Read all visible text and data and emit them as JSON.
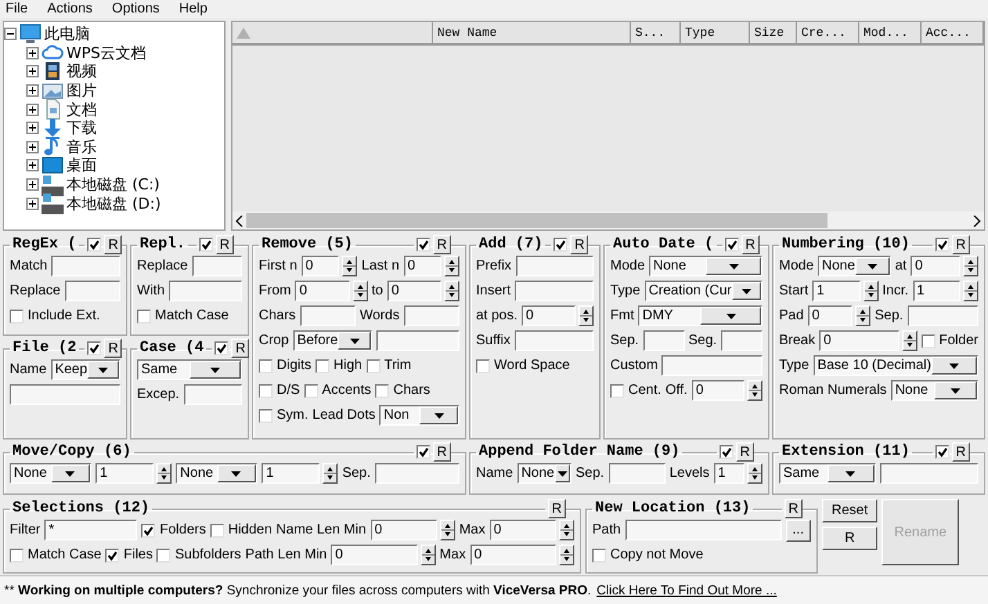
{
  "menu": [
    "File",
    "Actions",
    "Options",
    "Help"
  ],
  "tree": {
    "label": "此电脑",
    "kind": "computer",
    "expanded": true,
    "children": [
      {
        "label": "WPS云文档",
        "kind": "cloud",
        "expanded": false
      },
      {
        "label": "视频",
        "kind": "video",
        "expanded": false
      },
      {
        "label": "图片",
        "kind": "picture",
        "expanded": false
      },
      {
        "label": "文档",
        "kind": "document",
        "expanded": false
      },
      {
        "label": "下载",
        "kind": "download",
        "expanded": false
      },
      {
        "label": "音乐",
        "kind": "music",
        "expanded": false
      },
      {
        "label": "桌面",
        "kind": "desktop",
        "expanded": false
      },
      {
        "label": "本地磁盘 (C:)",
        "kind": "drive",
        "expanded": false
      },
      {
        "label": "本地磁盘 (D:)",
        "kind": "drive",
        "expanded": false
      }
    ]
  },
  "file_list": {
    "columns": [
      {
        "kind": "sort"
      },
      {
        "label": "New Name"
      },
      {
        "label": "S..."
      },
      {
        "label": "Type"
      },
      {
        "label": "Size"
      },
      {
        "label": "Cre..."
      },
      {
        "label": "Mod..."
      },
      {
        "label": "Acc..."
      }
    ]
  },
  "panels": [
    {
      "title": "RegEx (",
      "enabled": true,
      "reset": "R",
      "rows": [
        {
          "items": [
            {
              "kind": "label",
              "text": "Match"
            },
            {
              "kind": "field"
            }
          ]
        },
        {
          "items": [
            {
              "kind": "label",
              "text": "Replace"
            },
            {
              "kind": "field"
            }
          ]
        },
        {
          "items": [
            {
              "kind": "check",
              "label": "Include Ext.",
              "checked": false
            }
          ]
        }
      ]
    },
    {
      "title": "Repl.",
      "enabled": true,
      "reset": "R",
      "rows": [
        {
          "items": [
            {
              "kind": "label",
              "text": "Replace"
            },
            {
              "kind": "field"
            }
          ]
        },
        {
          "items": [
            {
              "kind": "label",
              "text": "With"
            },
            {
              "kind": "field"
            }
          ]
        },
        {
          "items": [
            {
              "kind": "check",
              "label": "Match Case",
              "checked": false
            }
          ]
        }
      ]
    },
    {
      "title": "Remove (5)",
      "enabled": true,
      "reset": "R",
      "rows": [
        {
          "items": [
            {
              "kind": "label",
              "text": "First n"
            },
            {
              "kind": "spin",
              "value": "0"
            },
            {
              "kind": "label",
              "text": "Last n"
            },
            {
              "kind": "spin",
              "value": "0"
            }
          ]
        },
        {
          "items": [
            {
              "kind": "label",
              "text": "From"
            },
            {
              "kind": "spin",
              "value": "0"
            },
            {
              "kind": "label",
              "text": "to"
            },
            {
              "kind": "spin",
              "value": "0"
            }
          ]
        },
        {
          "items": [
            {
              "kind": "label",
              "text": "Chars"
            },
            {
              "kind": "field"
            },
            {
              "kind": "label",
              "text": "Words"
            },
            {
              "kind": "field"
            }
          ]
        },
        {
          "items": [
            {
              "kind": "label",
              "text": "Crop"
            },
            {
              "kind": "select",
              "value": "Before"
            },
            {
              "kind": "field"
            }
          ]
        },
        {
          "items": [
            {
              "kind": "check",
              "label": "Digits",
              "checked": false
            },
            {
              "kind": "check",
              "label": "High",
              "checked": false
            },
            {
              "kind": "check",
              "label": "Trim",
              "checked": false
            }
          ]
        },
        {
          "items": [
            {
              "kind": "check",
              "label": "D/S",
              "checked": false
            },
            {
              "kind": "check",
              "label": "Accents",
              "checked": false
            },
            {
              "kind": "check",
              "label": "Chars",
              "checked": false
            }
          ]
        },
        {
          "items": [
            {
              "kind": "check",
              "label": "Sym.",
              "checked": false
            },
            {
              "kind": "label",
              "text": "Lead Dots"
            },
            {
              "kind": "select",
              "value": "Non"
            }
          ]
        }
      ]
    },
    {
      "title": "Add (7)",
      "enabled": true,
      "reset": "R",
      "rows": [
        {
          "items": [
            {
              "kind": "label",
              "text": "Prefix"
            },
            {
              "kind": "field"
            }
          ]
        },
        {
          "items": [
            {
              "kind": "label",
              "text": "Insert"
            },
            {
              "kind": "field"
            }
          ]
        },
        {
          "items": [
            {
              "kind": "label",
              "text": "at pos."
            },
            {
              "kind": "spin",
              "value": "0"
            }
          ]
        },
        {
          "items": [
            {
              "kind": "label",
              "text": "Suffix"
            },
            {
              "kind": "field"
            }
          ]
        },
        {
          "items": [
            {
              "kind": "check",
              "label": "Word Space",
              "checked": false
            }
          ]
        }
      ]
    },
    {
      "title": "Auto Date (",
      "enabled": true,
      "reset": "R",
      "rows": [
        {
          "items": [
            {
              "kind": "label",
              "text": "Mode"
            },
            {
              "kind": "select",
              "value": "None"
            }
          ]
        },
        {
          "items": [
            {
              "kind": "label",
              "text": "Type"
            },
            {
              "kind": "select",
              "value": "Creation (Cur"
            }
          ]
        },
        {
          "items": [
            {
              "kind": "label",
              "text": "Fmt"
            },
            {
              "kind": "select",
              "value": "DMY"
            }
          ]
        },
        {
          "items": [
            {
              "kind": "label",
              "text": "Sep."
            },
            {
              "kind": "field"
            },
            {
              "kind": "label",
              "text": "Seg."
            },
            {
              "kind": "field"
            }
          ]
        },
        {
          "items": [
            {
              "kind": "label",
              "text": "Custom"
            },
            {
              "kind": "field"
            }
          ]
        },
        {
          "items": [
            {
              "kind": "check",
              "label": "Cent.",
              "checked": false
            },
            {
              "kind": "label",
              "text": "Off."
            },
            {
              "kind": "spin",
              "value": "0"
            }
          ]
        }
      ]
    },
    {
      "title": "Numbering (10)",
      "enabled": true,
      "reset": "R",
      "rows": [
        {
          "items": [
            {
              "kind": "label",
              "text": "Mode"
            },
            {
              "kind": "select",
              "value": "None"
            },
            {
              "kind": "label",
              "text": "at"
            },
            {
              "kind": "spin",
              "value": "0"
            }
          ]
        },
        {
          "items": [
            {
              "kind": "label",
              "text": "Start"
            },
            {
              "kind": "spin",
              "value": "1"
            },
            {
              "kind": "label",
              "text": "Incr."
            },
            {
              "kind": "spin",
              "value": "1"
            }
          ]
        },
        {
          "items": [
            {
              "kind": "label",
              "text": "Pad"
            },
            {
              "kind": "spin",
              "value": "0"
            },
            {
              "kind": "label",
              "text": "Sep."
            },
            {
              "kind": "field"
            }
          ]
        },
        {
          "items": [
            {
              "kind": "label",
              "text": "Break"
            },
            {
              "kind": "spin",
              "value": "0"
            },
            {
              "kind": "check",
              "label": "Folder",
              "checked": false
            }
          ]
        },
        {
          "items": [
            {
              "kind": "label",
              "text": "Type"
            },
            {
              "kind": "select",
              "value": "Base 10 (Decimal)"
            }
          ]
        },
        {
          "items": [
            {
              "kind": "label",
              "text": "Roman Numerals"
            },
            {
              "kind": "select",
              "value": "None"
            }
          ]
        }
      ]
    },
    {
      "title": "File (2",
      "enabled": true,
      "reset": "R",
      "rows": [
        {
          "items": [
            {
              "kind": "label",
              "text": "Name"
            },
            {
              "kind": "select",
              "value": "Keep"
            }
          ]
        },
        {
          "items": [
            {
              "kind": "field"
            }
          ]
        }
      ]
    },
    {
      "title": "Case (4",
      "enabled": true,
      "reset": "R",
      "rows": [
        {
          "items": [
            {
              "kind": "select",
              "value": "Same"
            }
          ]
        },
        {
          "items": [
            {
              "kind": "label",
              "text": "Excep."
            },
            {
              "kind": "field"
            }
          ]
        }
      ]
    },
    {
      "title": "Move/Copy (6)",
      "enabled": true,
      "reset": "R",
      "rows": [
        {
          "items": [
            {
              "kind": "select",
              "value": "None"
            },
            {
              "kind": "spin",
              "value": "1"
            },
            {
              "kind": "select",
              "value": "None"
            },
            {
              "kind": "spin",
              "value": "1"
            },
            {
              "kind": "label",
              "text": "Sep."
            },
            {
              "kind": "field"
            }
          ]
        }
      ]
    },
    {
      "title": "Append Folder Name (9)",
      "enabled": true,
      "reset": "R",
      "rows": [
        {
          "items": [
            {
              "kind": "label",
              "text": "Name"
            },
            {
              "kind": "select",
              "value": "None"
            },
            {
              "kind": "label",
              "text": "Sep."
            },
            {
              "kind": "field"
            },
            {
              "kind": "label",
              "text": "Levels"
            },
            {
              "kind": "spin",
              "value": "1"
            }
          ]
        }
      ]
    },
    {
      "title": "Extension (11)",
      "enabled": true,
      "reset": "R",
      "rows": [
        {
          "items": [
            {
              "kind": "select",
              "value": "Same"
            },
            {
              "kind": "field"
            }
          ]
        }
      ]
    },
    {
      "title": "Selections (12)",
      "reset": "R",
      "rows": [
        {
          "items": [
            {
              "kind": "label",
              "text": "Filter"
            },
            {
              "kind": "field",
              "value": "*"
            },
            {
              "kind": "check",
              "label": "Folders",
              "checked": true
            },
            {
              "kind": "check",
              "label": "Hidden",
              "checked": false
            },
            {
              "kind": "label",
              "text": "Name Len Min"
            },
            {
              "kind": "spin",
              "value": "0"
            },
            {
              "kind": "label",
              "text": "Max"
            },
            {
              "kind": "spin",
              "value": "0"
            }
          ]
        },
        {
          "items": [
            {
              "kind": "check",
              "label": "Match Case",
              "checked": false
            },
            {
              "kind": "check",
              "label": "Files",
              "checked": true
            },
            {
              "kind": "check",
              "label": "Subfolders",
              "checked": false
            },
            {
              "kind": "label",
              "text": "Path Len Min"
            },
            {
              "kind": "spin",
              "value": "0"
            },
            {
              "kind": "label",
              "text": "Max"
            },
            {
              "kind": "spin",
              "value": "0"
            }
          ]
        }
      ]
    },
    {
      "title": "New Location (13)",
      "reset": "R",
      "rows": [
        {
          "items": [
            {
              "kind": "label",
              "text": "Path"
            },
            {
              "kind": "field"
            },
            {
              "kind": "button",
              "label": "..."
            }
          ]
        },
        {
          "items": [
            {
              "kind": "check",
              "label": "Copy not Move",
              "checked": false
            }
          ]
        }
      ]
    }
  ],
  "buttons": [
    {
      "label": "Reset",
      "disabled": false
    },
    {
      "label": "R",
      "disabled": false
    },
    {
      "label": "Rename",
      "disabled": true
    }
  ],
  "status_bar": {
    "message": "** **Working on multiple computers?** Synchronize your files across computers with **ViceVersa PRO**.",
    "link": "Click Here To Find Out More ..."
  }
}
